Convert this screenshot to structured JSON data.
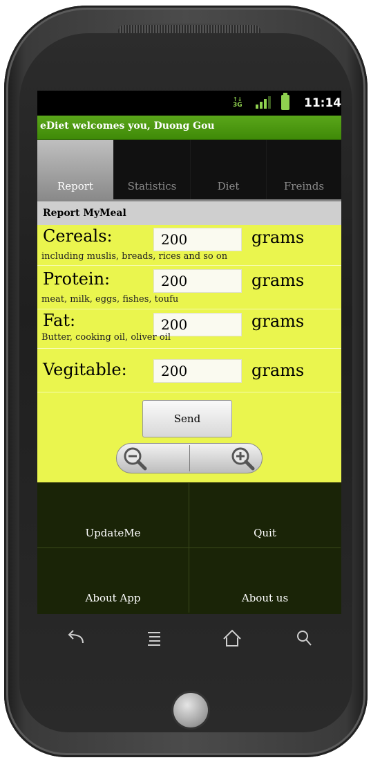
{
  "status_bar": {
    "network": "3G",
    "time": "11:14"
  },
  "app": {
    "title": "eDiet welcomes you, Duong Gou"
  },
  "tabs": [
    {
      "label": "Report",
      "active": true
    },
    {
      "label": "Statistics",
      "active": false
    },
    {
      "label": "Diet",
      "active": false
    },
    {
      "label": "Freinds",
      "active": false
    }
  ],
  "section_header": "Report MyMeal",
  "form": {
    "rows": [
      {
        "label": "Cereals:",
        "value": "200",
        "unit": "grams",
        "hint": "including muslis, breads, rices and so on"
      },
      {
        "label": "Protein:",
        "value": "200",
        "unit": "grams",
        "hint": "meat, milk, eggs, fishes, toufu"
      },
      {
        "label": "Fat:",
        "value": "200",
        "unit": "grams",
        "hint": "Butter, cooking oil, oliver oil"
      },
      {
        "label": "Vegitable:",
        "value": "200",
        "unit": "grams",
        "hint": ""
      }
    ],
    "send_label": "Send"
  },
  "menu": [
    {
      "label": "UpdateMe"
    },
    {
      "label": "Quit"
    },
    {
      "label": "About App"
    },
    {
      "label": "About us"
    }
  ],
  "colors": {
    "title_bar": "#4a9a10",
    "form_bg": "#eaf54e",
    "menu_bg": "#1a2407"
  },
  "icons": {
    "zoom_out": "zoom-out-icon",
    "zoom_in": "zoom-in-icon",
    "back": "back-icon",
    "menu": "menu-icon",
    "home": "home-icon",
    "search": "search-icon"
  }
}
